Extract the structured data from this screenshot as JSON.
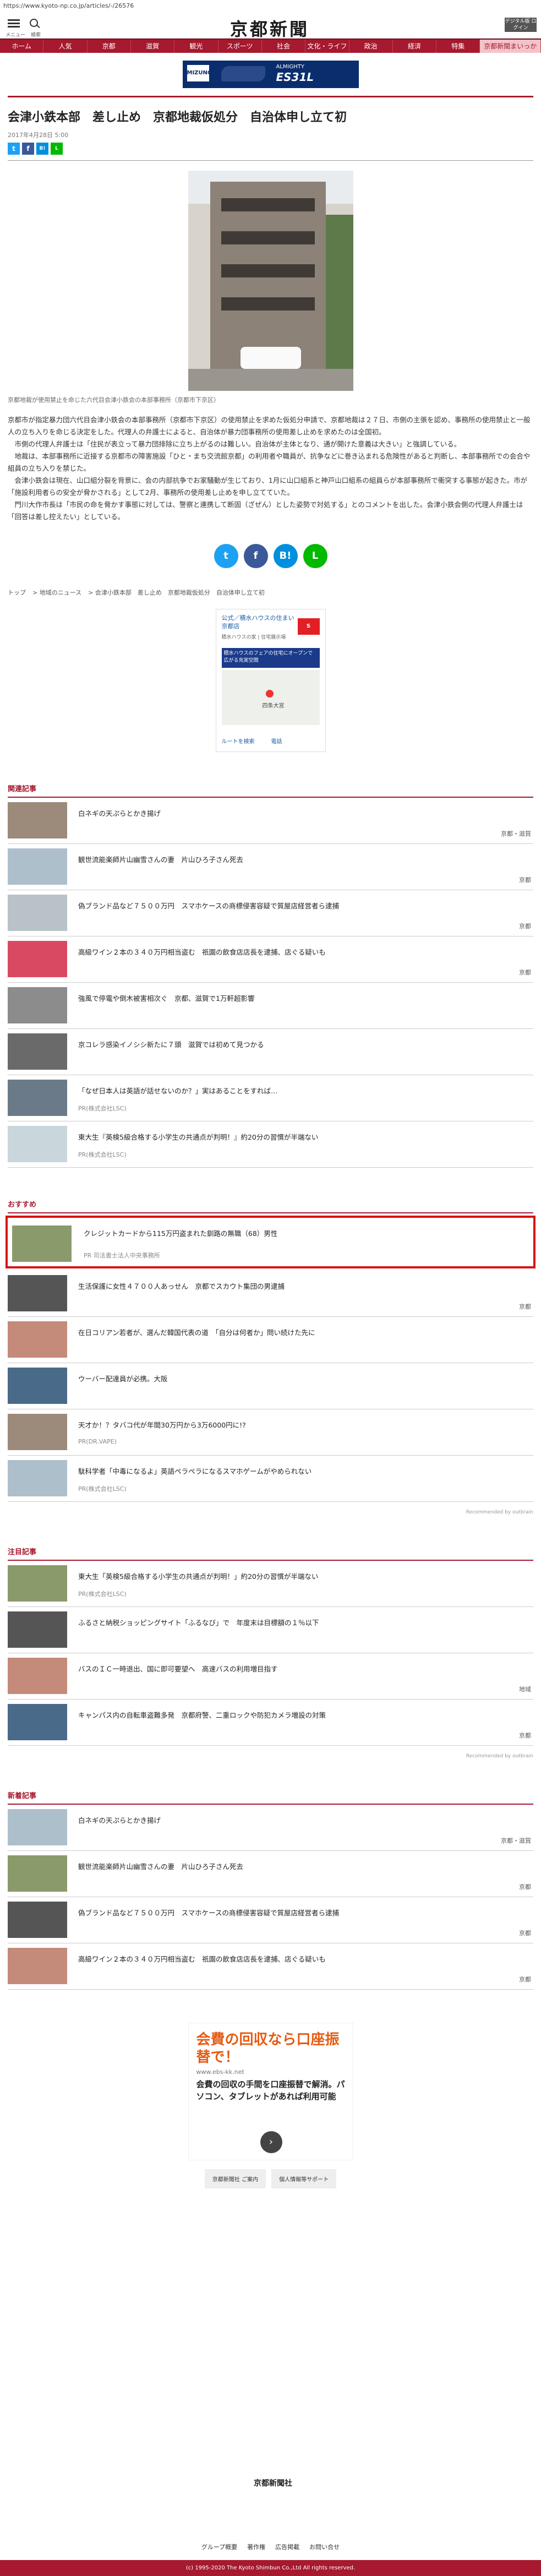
{
  "url": "https://www.kyoto-np.co.jp/articles/-/26576",
  "header": {
    "menu_label": "メニュー",
    "search_label": "検索",
    "logo": "京都新聞",
    "digital_label": "デジタル版 ログイン"
  },
  "nav": [
    "ホーム",
    "人気",
    "京都",
    "滋賀",
    "観光",
    "スポーツ",
    "社会",
    "文化・ライフ",
    "政治",
    "経済",
    "特集",
    "京都新聞まいっか"
  ],
  "top_ad": {
    "brand": "MIZUNO",
    "model": "ES31L",
    "tag": "ALMIGHTY"
  },
  "article": {
    "title": "会津小鉄本部　差し止め　京都地裁仮処分　自治体申し立て初",
    "date": "2017年4月28日 5:00",
    "caption": "京都地裁が使用禁止を命じた六代目会津小鉄会の本部事務所（京都市下京区）",
    "body": [
      "京都市が指定暴力団六代目会津小鉄会の本部事務所（京都市下京区）の使用禁止を求めた仮処分申請で、京都地裁は２７日、市側の主張を認め、事務所の使用禁止と一般人の立ち入りを命じる決定をした。代理人の弁護士によると、自治体が暴力団事務所の使用差し止めを求めたのは全国初。",
      "　市側の代理人弁護士は「住民が表立って暴力団排除に立ち上がるのは難しい。自治体が主体となり、通が開けた意義は大きい」と強調している。",
      "　地裁は、本部事務所に近接する京都市の障害施設「ひと・まち交流館京都」の利用者や職員が、抗争などに巻き込まれる危険性があると判断し、本部事務所での会合や組員の立ち入りを禁じた。",
      "　会津小鉄会は現在、山口組分裂を背景に、会の内部抗争でお家騒動が生じており、1月に山口組系と神戸山口組系の組員らが本部事務所で衝突する事態が起きた。市が「施設利用者らの安全が脅かされる」として2月、事務所の使用差し止めを申し立てていた。",
      "　門川大作市長は「市民の命を脅かす事態に対しては、警察と連携して断固（ざぜん）とした姿勢で対処する」とのコメントを出した。会津小鉄会側の代理人弁護士は「回答は差し控えたい」としている。"
    ]
  },
  "share": [
    "t",
    "f",
    "B!",
    "L"
  ],
  "breadcrumb": [
    "トップ",
    "地域のニュース",
    "会津小鉄本部　差し止め　京都地裁仮処分　自治体申し立て初"
  ],
  "ad_box": {
    "headline": "公式／積水ハウスの住まい 京都店",
    "sub": "積水ハウスの家 | 住宅展示場",
    "banner": "積水ハウスのフェアの住宅にオープンで広がる充実空間",
    "map_label": "四条大宮",
    "route": "ルートを検索",
    "call": "電話"
  },
  "related": {
    "heading": "関連記事",
    "items": [
      {
        "text": "白ネギの天ぷらとかき揚げ",
        "cat": "京都・滋賀"
      },
      {
        "text": "観世流能楽師片山幽雪さんの妻　片山ひろ子さん死去",
        "cat": "京都"
      },
      {
        "text": "偽ブランド品など７５００万円　スマホケースの商標侵害容疑で質屋店経営者ら逮捕",
        "cat": "京都"
      },
      {
        "text": "高級ワイン２本の３４０万円相当盗む　祇園の飲食店店長を逮捕、店ぐる疑いも",
        "cat": "京都"
      },
      {
        "text": "強風で停電や倒木被害相次ぐ　京都、滋賀で1万軒超影響",
        "cat": ""
      },
      {
        "text": "京コレラ感染イノシシ新たに７頭　滋賀では初めて見つかる",
        "cat": ""
      },
      {
        "text": "「なぜ日本人は英語が話せないのか？」実はあることをすれば…",
        "cat": "",
        "sub": "PR(株式会社LSC)"
      },
      {
        "text": "東大生『英検5級合格する小学生の共通点が判明！』約20分の習慣が半端ない",
        "cat": "",
        "sub": "PR(株式会社LSC)"
      }
    ]
  },
  "recommend": {
    "heading": "おすすめ",
    "items": [
      {
        "text": "クレジットカードから115万円盗まれた釧路の無職（68）男性",
        "sub": "PR 司法書士法人中央事務所"
      },
      {
        "text": "生活保護に女性４７００人あっせん　京都でスカウト集団の男逮捕",
        "cat": "京都"
      },
      {
        "text": "在日コリアン若者が、選んだ韓国代表の道　「自分は何者か」問い続けた先に",
        "cat": ""
      },
      {
        "text": "ウーバー配達員が必携。大阪",
        "cat": ""
      },
      {
        "text": "天才か！？タバコ代が年間30万円から3万6000円に!?",
        "sub": "PR(DR.VAPE)"
      },
      {
        "text": "駄科学者「中毒になるよ」英語ペラペラになるスマホゲームがやめられない",
        "sub": "PR(株式会社LSC)"
      }
    ],
    "by": "Recommended by outbrain"
  },
  "attention": {
    "heading": "注目記事",
    "items": [
      {
        "text": "東大生「英検5級合格する小学生の共通点が判明！」約20分の習慣が半端ない",
        "sub": "PR(株式会社LSC)"
      },
      {
        "text": "ふるさと納税ショッピングサイト「ふるなび」で　年度末は目標額の１％以下",
        "cat": ""
      },
      {
        "text": "バスのＩＣ一時退出、国に即可要望へ　高速バスの利用増目指す",
        "cat": "地域"
      },
      {
        "text": "キャンパス内の自転車盗難多発　京都府警、二重ロックや防犯カメラ増設の対策",
        "cat": "京都"
      }
    ],
    "by": "Recommended by outbrain"
  },
  "latest": {
    "heading": "新着記事",
    "items": [
      {
        "text": "白ネギの天ぷらとかき揚げ",
        "cat": "京都・滋賀"
      },
      {
        "text": "観世流能楽師片山幽雪さんの妻　片山ひろ子さん死去",
        "cat": "京都"
      },
      {
        "text": "偽ブランド品など７５００万円　スマホケースの商標侵害容疑で質屋店経営者ら逮捕",
        "cat": "京都"
      },
      {
        "text": "高級ワイン２本の３４０万円相当盗む　祇園の飲食店店長を逮捕、店ぐる疑いも",
        "cat": "京都"
      }
    ]
  },
  "bottom_ad": {
    "headline": "会費の回収なら口座振替で！",
    "url": "www.ebs-kk.net",
    "body": "会費の回収の手間を口座振替で解消。パソコン、タブレットがあれば利用可能",
    "btn1": "京都新聞社 ご案内",
    "btn2": "個人情報等サポート"
  },
  "footer": {
    "logo": "京都新聞社",
    "links": [
      "グループ概要",
      "著作権",
      "広告掲載",
      "お問い合せ"
    ],
    "copyright": "(c) 1995-2020 The Kyoto Shimbun Co.,Ltd All rights reserved."
  }
}
